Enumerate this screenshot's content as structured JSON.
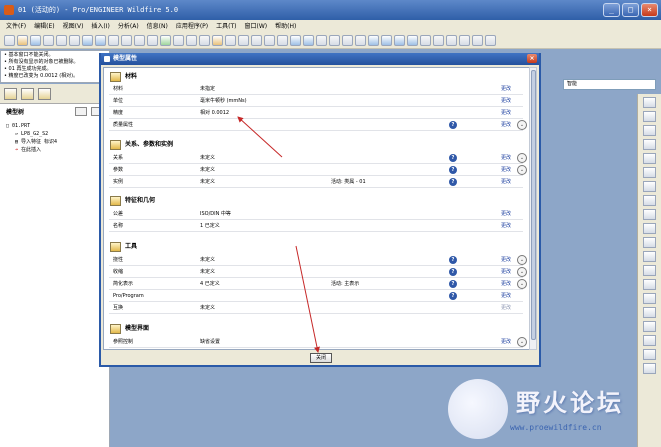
{
  "window": {
    "title": "01 (活动的) - Pro/ENGINEER Wildfire 5.0"
  },
  "menu": [
    "文件(F)",
    "编辑(E)",
    "视图(V)",
    "插入(I)",
    "分析(A)",
    "信息(N)",
    "应用程序(P)",
    "工具(T)",
    "窗口(W)",
    "帮助(H)"
  ],
  "messages": [
    "基本窗口不能关闭。",
    "所有没有显示的对象已被删除。",
    "01 再生成功完成。",
    "精度已改变为 0.0012 (相对)。"
  ],
  "model_tree": {
    "title": "模型树",
    "items": [
      "01.PRT",
      "LP8_G2_S2",
      "导入特征 标识4",
      "在此插入"
    ]
  },
  "smart_filter": "智能",
  "dialog": {
    "title": "模型属性",
    "close_label": "关闭",
    "change_label": "更改",
    "sections": [
      {
        "title": "材料",
        "rows": [
          {
            "key": "材料",
            "value": "未指定"
          },
          {
            "key": "单位",
            "value": "毫米牛顿秒 (mmNs)"
          },
          {
            "key": "精度",
            "value": "相对 0.0012"
          },
          {
            "key": "质量属性",
            "value": ""
          }
        ]
      },
      {
        "title": "关系、参数和实例",
        "rows": [
          {
            "key": "关系",
            "value": "未定义"
          },
          {
            "key": "参数",
            "value": "未定义"
          },
          {
            "key": "实例",
            "value": "未定义",
            "extra": "活动: 类属 - 01"
          }
        ]
      },
      {
        "title": "特征和几何",
        "rows": [
          {
            "key": "公差",
            "value": "ISO/DIN 中等"
          },
          {
            "key": "名称",
            "value": "1 已定义"
          }
        ]
      },
      {
        "title": "工具",
        "rows": [
          {
            "key": "挠性",
            "value": "未定义"
          },
          {
            "key": "收缩",
            "value": "未定义"
          },
          {
            "key": "简化表示",
            "value": "4 已定义",
            "extra": "活动: 主表示"
          },
          {
            "key": "Pro/Program",
            "value": ""
          },
          {
            "key": "互换",
            "value": "未定义"
          }
        ]
      },
      {
        "title": "模型界面",
        "rows": [
          {
            "key": "参照控制",
            "value": "缺省设置"
          }
        ]
      }
    ]
  },
  "watermark": {
    "text": "野火论坛",
    "url": "www.proewildfire.cn"
  },
  "colors": {
    "title_bar": "#2f5fa8",
    "dialog_bg": "#ece9d8",
    "link": "#1c3fa0",
    "arrow": "#c62828"
  }
}
